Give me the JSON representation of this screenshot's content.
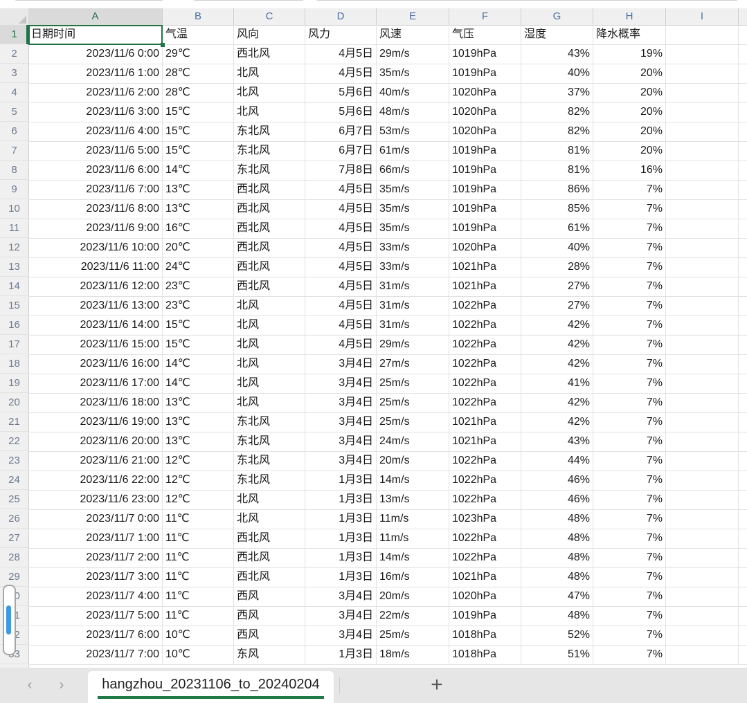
{
  "app": {
    "type": "spreadsheet",
    "selected_cell": "A1",
    "accent_color": "#217346",
    "scrollbar_thumb_color": "#3b9ae1"
  },
  "grid": {
    "column_headers": [
      "A",
      "B",
      "C",
      "D",
      "E",
      "F",
      "G",
      "H",
      "I"
    ],
    "active_column": "A",
    "active_row": "1",
    "row_numbers": [
      "1",
      "2",
      "3",
      "4",
      "5",
      "6",
      "7",
      "8",
      "9",
      "10",
      "11",
      "12",
      "13",
      "14",
      "15",
      "16",
      "17",
      "18",
      "19",
      "20",
      "21",
      "22",
      "23",
      "24",
      "25",
      "26",
      "27",
      "28",
      "29",
      "30",
      "31",
      "32",
      "33"
    ],
    "header_row": [
      "日期时间",
      "气温",
      "风向",
      "风力",
      "风速",
      "气压",
      "湿度",
      "降水概率"
    ],
    "rows": [
      [
        "2023/11/6 0:00",
        "29℃",
        "西北风",
        "4月5日",
        "29m/s",
        "1019hPa",
        "43%",
        "19%"
      ],
      [
        "2023/11/6 1:00",
        "28℃",
        "北风",
        "4月5日",
        "35m/s",
        "1019hPa",
        "40%",
        "20%"
      ],
      [
        "2023/11/6 2:00",
        "28℃",
        "北风",
        "5月6日",
        "40m/s",
        "1020hPa",
        "37%",
        "20%"
      ],
      [
        "2023/11/6 3:00",
        "15℃",
        "北风",
        "5月6日",
        "48m/s",
        "1020hPa",
        "82%",
        "20%"
      ],
      [
        "2023/11/6 4:00",
        "15℃",
        "东北风",
        "6月7日",
        "53m/s",
        "1020hPa",
        "82%",
        "20%"
      ],
      [
        "2023/11/6 5:00",
        "15℃",
        "东北风",
        "6月7日",
        "61m/s",
        "1019hPa",
        "81%",
        "20%"
      ],
      [
        "2023/11/6 6:00",
        "14℃",
        "东北风",
        "7月8日",
        "66m/s",
        "1019hPa",
        "81%",
        "16%"
      ],
      [
        "2023/11/6 7:00",
        "13℃",
        "西北风",
        "4月5日",
        "35m/s",
        "1019hPa",
        "86%",
        "7%"
      ],
      [
        "2023/11/6 8:00",
        "13℃",
        "西北风",
        "4月5日",
        "35m/s",
        "1019hPa",
        "85%",
        "7%"
      ],
      [
        "2023/11/6 9:00",
        "16℃",
        "西北风",
        "4月5日",
        "35m/s",
        "1019hPa",
        "61%",
        "7%"
      ],
      [
        "2023/11/6 10:00",
        "20℃",
        "西北风",
        "4月5日",
        "33m/s",
        "1020hPa",
        "40%",
        "7%"
      ],
      [
        "2023/11/6 11:00",
        "24℃",
        "西北风",
        "4月5日",
        "33m/s",
        "1021hPa",
        "28%",
        "7%"
      ],
      [
        "2023/11/6 12:00",
        "23℃",
        "西北风",
        "4月5日",
        "31m/s",
        "1021hPa",
        "27%",
        "7%"
      ],
      [
        "2023/11/6 13:00",
        "23℃",
        "北风",
        "4月5日",
        "31m/s",
        "1022hPa",
        "27%",
        "7%"
      ],
      [
        "2023/11/6 14:00",
        "15℃",
        "北风",
        "4月5日",
        "31m/s",
        "1022hPa",
        "42%",
        "7%"
      ],
      [
        "2023/11/6 15:00",
        "15℃",
        "北风",
        "4月5日",
        "29m/s",
        "1022hPa",
        "42%",
        "7%"
      ],
      [
        "2023/11/6 16:00",
        "14℃",
        "北风",
        "3月4日",
        "27m/s",
        "1022hPa",
        "42%",
        "7%"
      ],
      [
        "2023/11/6 17:00",
        "14℃",
        "北风",
        "3月4日",
        "25m/s",
        "1022hPa",
        "41%",
        "7%"
      ],
      [
        "2023/11/6 18:00",
        "13℃",
        "北风",
        "3月4日",
        "25m/s",
        "1022hPa",
        "42%",
        "7%"
      ],
      [
        "2023/11/6 19:00",
        "13℃",
        "东北风",
        "3月4日",
        "25m/s",
        "1021hPa",
        "42%",
        "7%"
      ],
      [
        "2023/11/6 20:00",
        "13℃",
        "东北风",
        "3月4日",
        "24m/s",
        "1021hPa",
        "43%",
        "7%"
      ],
      [
        "2023/11/6 21:00",
        "12℃",
        "东北风",
        "3月4日",
        "20m/s",
        "1022hPa",
        "44%",
        "7%"
      ],
      [
        "2023/11/6 22:00",
        "12℃",
        "东北风",
        "1月3日",
        "14m/s",
        "1022hPa",
        "46%",
        "7%"
      ],
      [
        "2023/11/6 23:00",
        "12℃",
        "北风",
        "1月3日",
        "13m/s",
        "1022hPa",
        "46%",
        "7%"
      ],
      [
        "2023/11/7 0:00",
        "11℃",
        "北风",
        "1月3日",
        "11m/s",
        "1023hPa",
        "48%",
        "7%"
      ],
      [
        "2023/11/7 1:00",
        "11℃",
        "西北风",
        "1月3日",
        "11m/s",
        "1022hPa",
        "48%",
        "7%"
      ],
      [
        "2023/11/7 2:00",
        "11℃",
        "西北风",
        "1月3日",
        "14m/s",
        "1022hPa",
        "48%",
        "7%"
      ],
      [
        "2023/11/7 3:00",
        "11℃",
        "西北风",
        "1月3日",
        "16m/s",
        "1021hPa",
        "48%",
        "7%"
      ],
      [
        "2023/11/7 4:00",
        "11℃",
        "西风",
        "3月4日",
        "20m/s",
        "1020hPa",
        "47%",
        "7%"
      ],
      [
        "2023/11/7 5:00",
        "11℃",
        "西风",
        "3月4日",
        "22m/s",
        "1019hPa",
        "48%",
        "7%"
      ],
      [
        "2023/11/7 6:00",
        "10℃",
        "西风",
        "3月4日",
        "25m/s",
        "1018hPa",
        "52%",
        "7%"
      ],
      [
        "2023/11/7 7:00",
        "10℃",
        "东风",
        "1月3日",
        "18m/s",
        "1018hPa",
        "51%",
        "7%"
      ]
    ],
    "column_alignment": [
      "right",
      "left",
      "left",
      "right",
      "left",
      "left",
      "right",
      "right"
    ]
  },
  "tabbar": {
    "prev_label": "‹",
    "next_label": "›",
    "sheet_name": "hangzhou_20231106_to_20240204",
    "add_label": "+"
  }
}
